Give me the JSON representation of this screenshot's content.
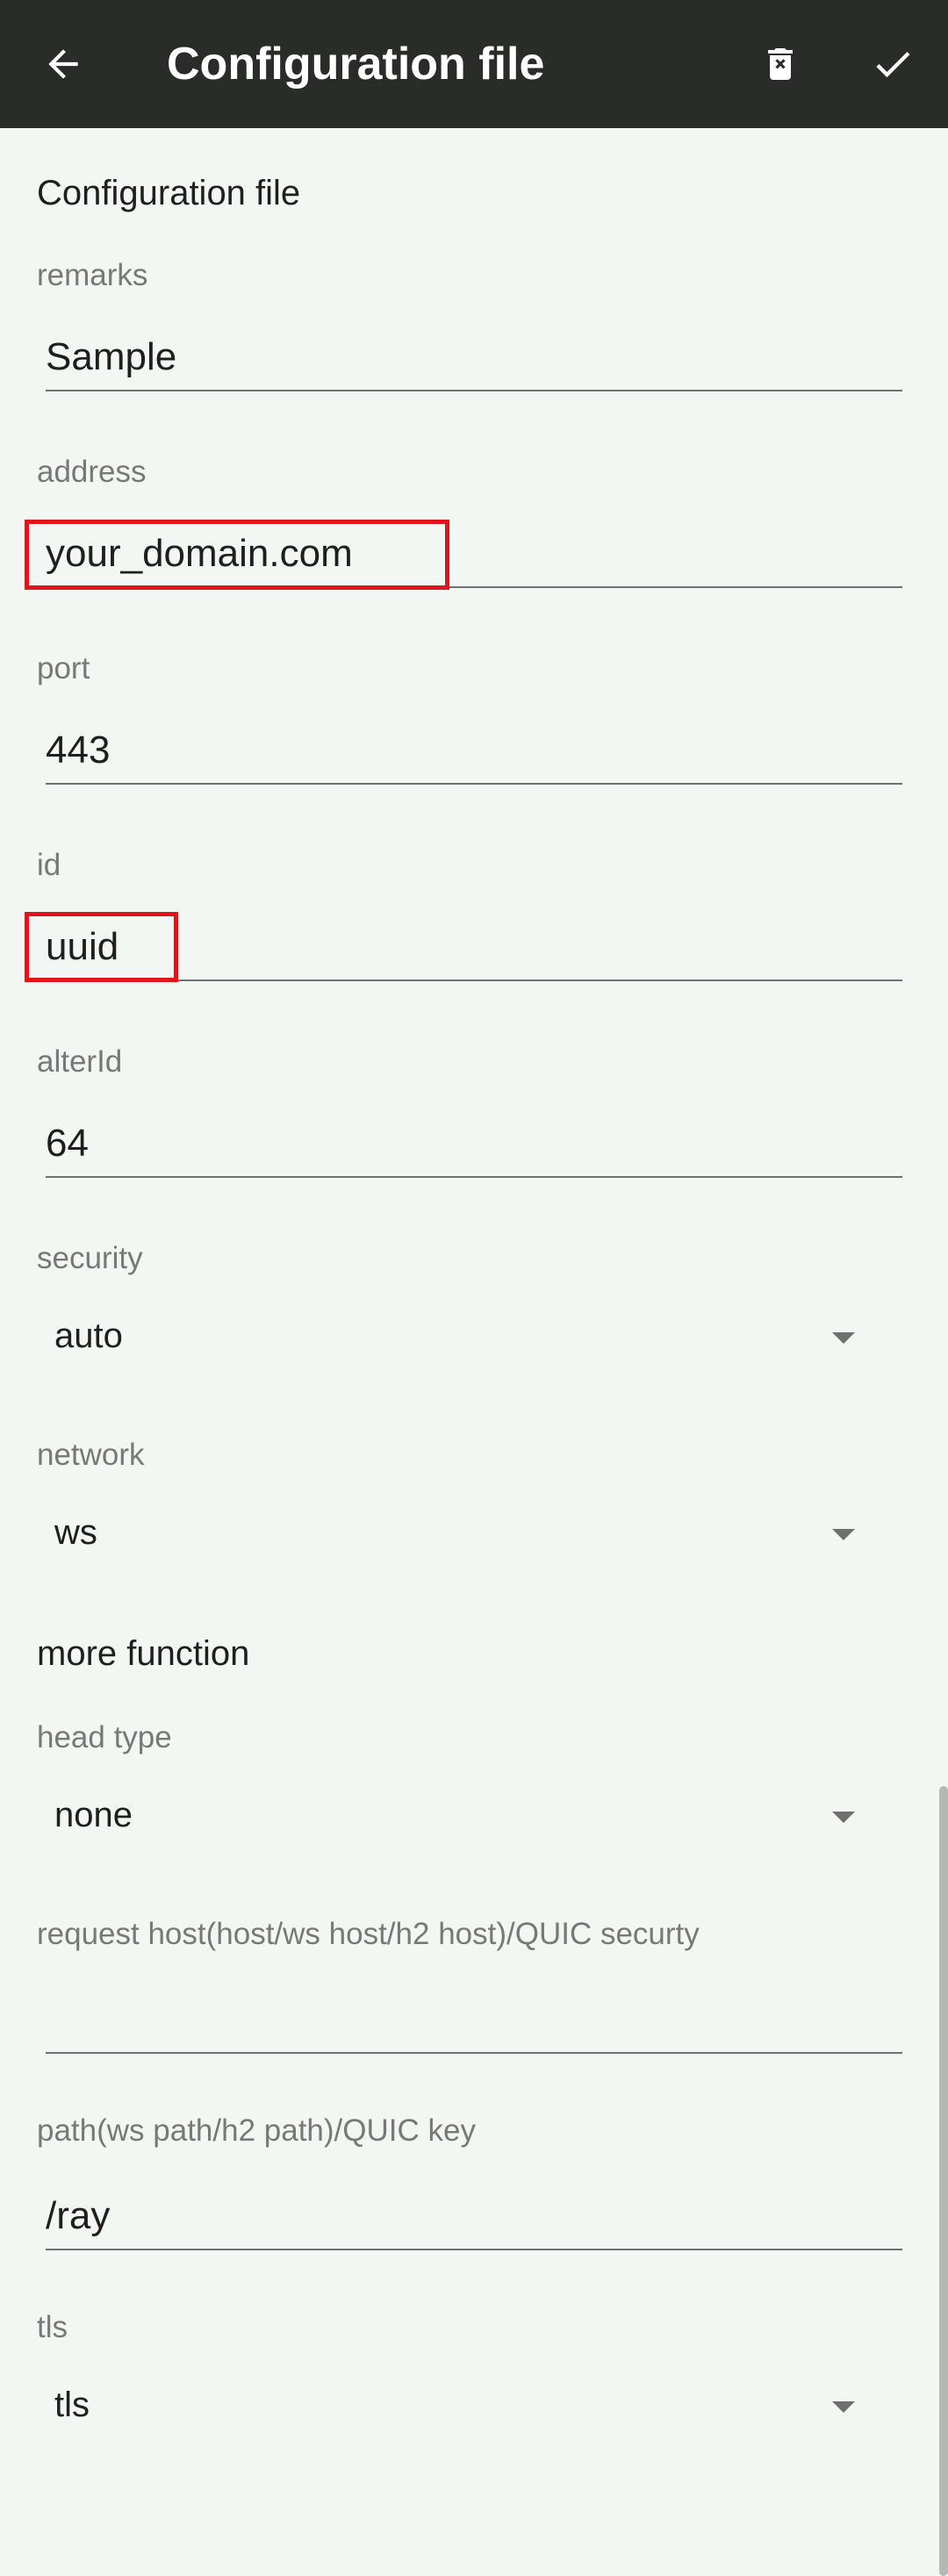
{
  "toolbar": {
    "title": "Configuration file",
    "back_icon": "arrow-left-icon",
    "delete_icon": "delete-icon",
    "confirm_icon": "check-icon"
  },
  "form": {
    "section_title": "Configuration file",
    "remarks": {
      "label": "remarks",
      "value": "Sample"
    },
    "address": {
      "label": "address",
      "value": "your_domain.com"
    },
    "port": {
      "label": "port",
      "value": "443"
    },
    "id": {
      "label": "id",
      "value": "uuid"
    },
    "alterId": {
      "label": "alterId",
      "value": "64"
    },
    "security": {
      "label": "security",
      "value": "auto"
    },
    "network": {
      "label": "network",
      "value": "ws"
    }
  },
  "more": {
    "section_title": "more function",
    "head_type": {
      "label": "head type",
      "value": "none"
    },
    "request_host": {
      "label": "request host(host/ws host/h2 host)/QUIC securty",
      "value": ""
    },
    "path": {
      "label": "path(ws path/h2 path)/QUIC key",
      "value": "/ray"
    },
    "tls": {
      "label": "tls",
      "value": "tls"
    }
  },
  "colors": {
    "toolbar_bg": "#2a2c2a",
    "page_bg": "#f3f7f4",
    "highlight": "#e0151b"
  }
}
